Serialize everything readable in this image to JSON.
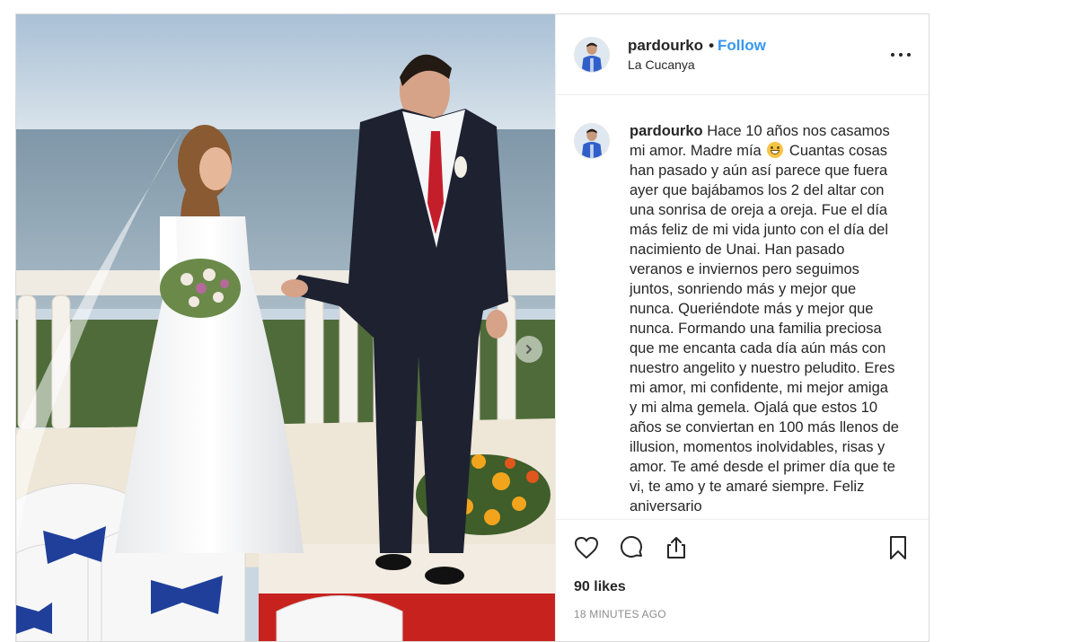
{
  "post": {
    "username": "pardourko",
    "follow_label": "Follow",
    "separator": "•",
    "location": "La Cucanya",
    "caption_user": "pardourko",
    "caption_part1": "Hace 10 años nos casamos mi amor. Madre mía",
    "caption_part2": "Cuantas cosas han pasado y aún así parece que fuera ayer que bajábamos los 2 del altar con una sonrisa de oreja a oreja. Fue el día más feliz de mi vida junto con el día del nacimiento de Unai. Han pasado veranos e inviernos pero seguimos juntos, sonriendo más y mejor que nunca. Queriéndote más y mejor que nunca. Formando una familia preciosa que me encanta cada día aún más con nuestro angelito y nuestro peludito. Eres mi amor, mi confidente, mi mejor amiga y mi alma gemela. Ojalá que estos 10 años se conviertan en 100 más llenos de illusion, momentos inolvidables, risas y amor. Te amé desde el primer día que te vi, te amo y te amaré siempre. Feliz aniversario",
    "likes": "90 likes",
    "timestamp": "18 MINUTES AGO"
  },
  "icons": {
    "more": "more-options-icon",
    "like": "heart-icon",
    "comment": "comment-icon",
    "share": "share-icon",
    "save": "bookmark-icon",
    "next": "chevron-right-icon"
  },
  "colors": {
    "follow": "#3897f0",
    "text": "#262626",
    "muted": "#8e8e8e",
    "border": "#dbdbdb"
  }
}
